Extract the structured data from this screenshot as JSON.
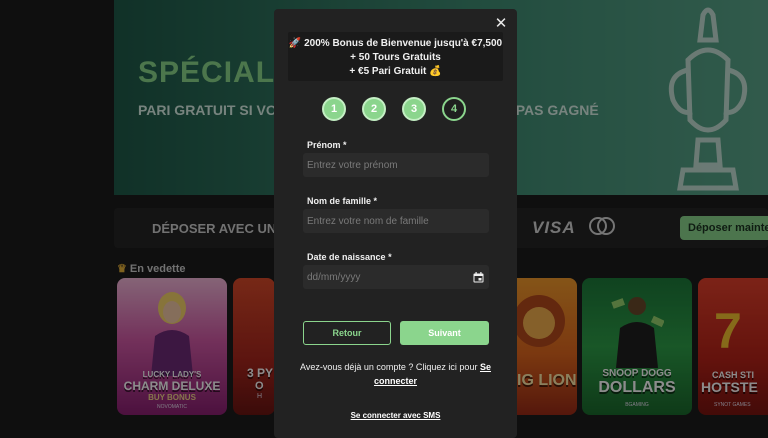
{
  "background": {
    "hero_title": "SPÉCIAL L",
    "hero_subtitle": "PARI GRATUIT SI VOTRE PARI EST PERDANT, MAIS N'A PAS GAGNÉ",
    "deposit_text": "DÉPOSER AVEC UNE M",
    "visa": "VISA",
    "deposit_button": "Déposer maintenant",
    "featured_label": "En vedette",
    "games": [
      {
        "title_top": "LUCKY LADY'S",
        "title": "CHARM DELUXE",
        "sub": "BUY BONUS",
        "maker": "NOVOMATIC"
      },
      {
        "title_top": "3 PY",
        "title": "",
        "sub": "O",
        "maker": "H"
      },
      {
        "title_top": "",
        "title": "IG LION",
        "sub": "",
        "maker": ""
      },
      {
        "title_top": "SNOOP DOGG",
        "title": "DOLLARS",
        "sub": "",
        "maker": "BGAMING"
      },
      {
        "title_top": "CASH STI",
        "title": "HOTSTE",
        "sub": "",
        "maker": "SYNOT GAMES"
      }
    ]
  },
  "modal": {
    "close_icon": "close-icon",
    "bonus": {
      "line1": "🚀 200% Bonus de Bienvenue jusqu'à €7,500",
      "line2": "+ 50 Tours Gratuits",
      "line3": "+ €5 Pari Gratuit 💰"
    },
    "steps": [
      "1",
      "2",
      "3",
      "4"
    ],
    "current_step": 4,
    "fields": {
      "first_name": {
        "label": "Prénom",
        "required": "*",
        "placeholder": "Entrez votre prénom"
      },
      "last_name": {
        "label": "Nom de famille",
        "required": "*",
        "placeholder": "Entrez votre nom de famille"
      },
      "birth_date": {
        "label": "Date de naissance",
        "required": "*",
        "placeholder": "dd/mm/yyyy"
      }
    },
    "back_button": "Retour",
    "next_button": "Suivant",
    "account_prompt": "Avez-vous déjà un compte ? Cliquez ici pour",
    "login_link": "Se connecter",
    "sms_link": "Se connecter avec SMS"
  },
  "colors": {
    "accent": "#8bd58d",
    "modal_bg": "#222222",
    "field_bg": "#2b2b2b"
  }
}
